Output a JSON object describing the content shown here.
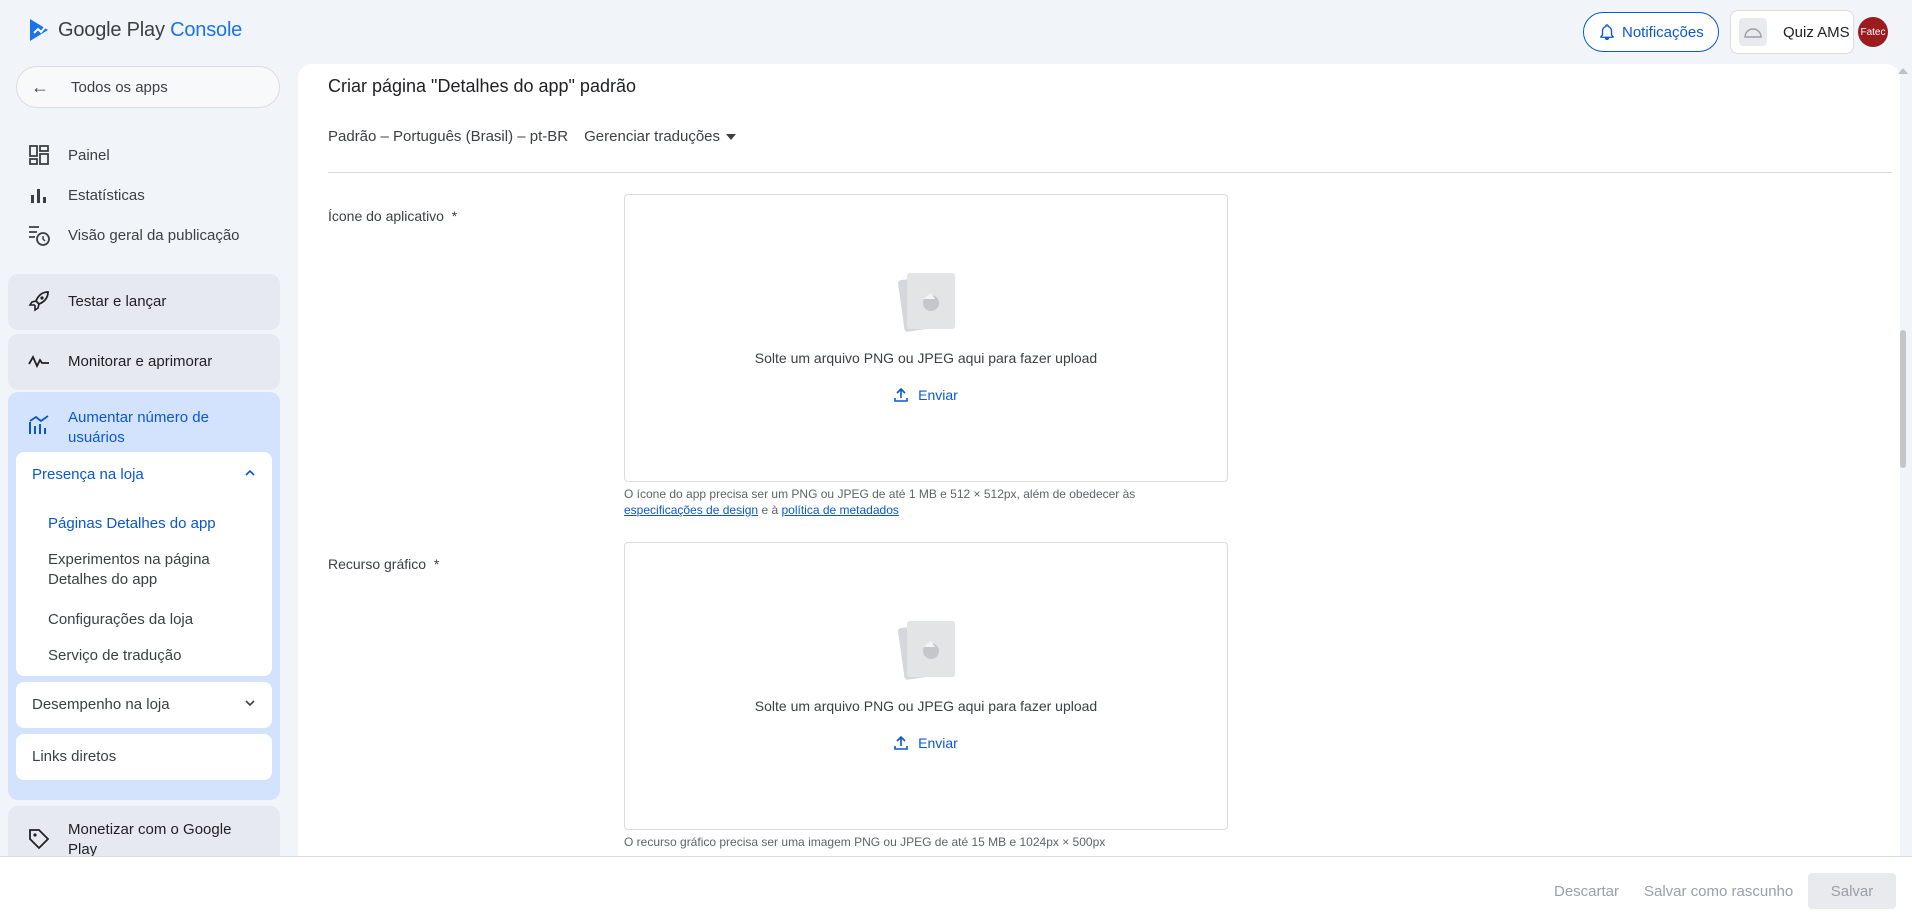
{
  "header": {
    "logo_brand": "Google Play",
    "logo_product": "Console",
    "notifications_label": "Notificações",
    "app_name": "Quiz AMS",
    "avatar_text": "Fatec",
    "avatar_color": "#9c1b1f"
  },
  "sidebar": {
    "back_label": "Todos os apps",
    "items": [
      {
        "label": "Painel",
        "icon": "dashboard-icon"
      },
      {
        "label": "Estatísticas",
        "icon": "bar-chart-icon"
      },
      {
        "label": "Visão geral da publicação",
        "icon": "publishing-overview-icon"
      }
    ],
    "sections": {
      "test_release": "Testar e lançar",
      "monitor": "Monitorar e aprimorar",
      "grow": "Aumentar número de usuários",
      "monetize": "Monetizar com o Google Play"
    },
    "store_presence": {
      "label": "Presença na loja",
      "items": [
        "Páginas Detalhes do app",
        "Experimentos na página Detalhes do app",
        "Configurações da loja",
        "Serviço de tradução"
      ]
    },
    "store_performance": "Desempenho na loja",
    "deep_links": "Links diretos"
  },
  "main": {
    "title": "Criar página \"Detalhes do app\" padrão",
    "language": "Padrão – Português (Brasil) – pt-BR",
    "manage_translations": "Gerenciar traduções",
    "app_icon": {
      "label": "Ícone do aplicativo",
      "required": "*",
      "drop_text": "Solte um arquivo PNG ou JPEG aqui para fazer upload",
      "upload_label": "Enviar",
      "hint_text": "O ícone do app precisa ser um PNG ou JPEG de até 1 MB e 512 × 512px, além de obedecer às",
      "hint_link1": "especificações de design",
      "hint_mid": "e à",
      "hint_link2": "política de metadados"
    },
    "feature_graphic": {
      "label": "Recurso gráfico",
      "required": "*",
      "drop_text": "Solte um arquivo PNG ou JPEG aqui para fazer upload",
      "upload_label": "Enviar",
      "hint_text": "O recurso gráfico precisa ser uma imagem PNG ou JPEG de até 15 MB e 1024px × 500px"
    }
  },
  "footer": {
    "discard": "Descartar",
    "save_draft": "Salvar como rascunho",
    "save": "Salvar"
  },
  "colors": {
    "accent": "#0b57d0",
    "active_section_bg": "#d3e3fd",
    "section_bg": "#e6eaf0"
  }
}
